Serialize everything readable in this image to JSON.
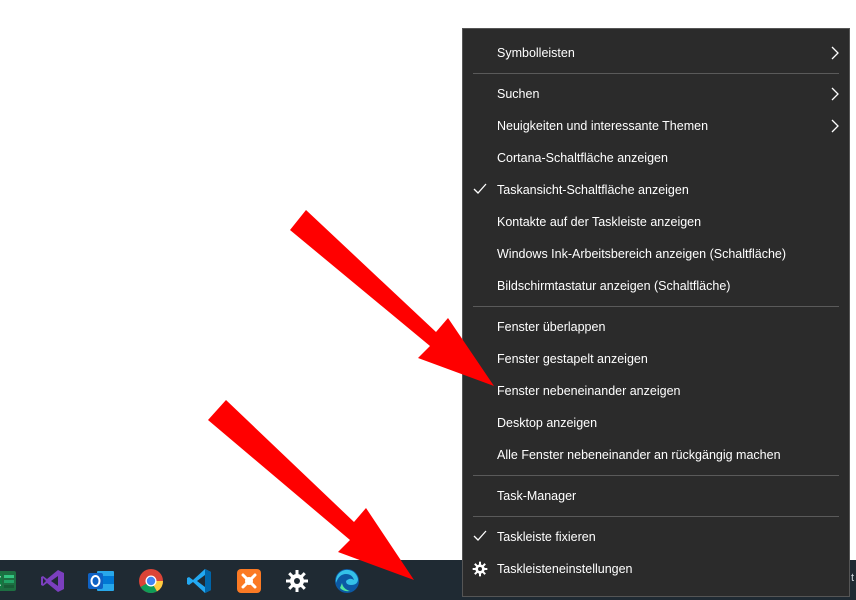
{
  "menu": {
    "items": [
      {
        "label": "Symbolleisten",
        "submenu": true
      },
      {
        "label": "Suchen",
        "submenu": true
      },
      {
        "label": "Neuigkeiten und interessante Themen",
        "submenu": true
      },
      {
        "label": "Cortana-Schaltfläche anzeigen"
      },
      {
        "label": "Taskansicht-Schaltfläche anzeigen",
        "checked": true
      },
      {
        "label": "Kontakte auf der Taskleiste anzeigen"
      },
      {
        "label": "Windows Ink-Arbeitsbereich anzeigen (Schaltfläche)"
      },
      {
        "label": "Bildschirmtastatur anzeigen (Schaltfläche)"
      },
      {
        "label": "Fenster überlappen"
      },
      {
        "label": "Fenster gestapelt anzeigen"
      },
      {
        "label": "Fenster nebeneinander anzeigen"
      },
      {
        "label": "Desktop anzeigen"
      },
      {
        "label": "Alle Fenster nebeneinander an rückgängig machen"
      },
      {
        "label": "Task-Manager"
      },
      {
        "label": "Taskleiste fixieren",
        "checked": true
      },
      {
        "label": "Taskleisteneinstellungen",
        "icon": "gear-icon"
      }
    ]
  },
  "taskbar": {
    "icons": [
      "excel-icon",
      "visual-studio-icon",
      "outlook-icon",
      "chrome-icon",
      "vscode-icon",
      "xampp-icon",
      "settings-gear-icon",
      "edge-icon"
    ],
    "tray_text": "t"
  },
  "colors": {
    "menu_bg": "#2b2b2b",
    "taskbar_bg": "#1f2a33",
    "arrow": "#ff0000"
  }
}
